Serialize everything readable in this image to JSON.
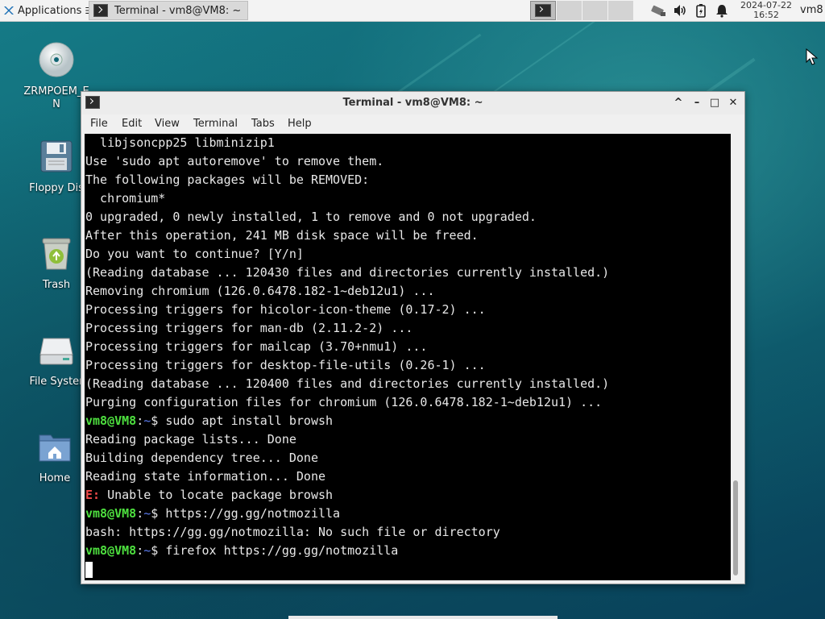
{
  "top_panel": {
    "applications_label": "Applications",
    "applications_suffix": "☰",
    "taskbar_item": "Terminal - vm8@VM8: ~",
    "clock_date": "2024-07-22",
    "clock_time": "16:52",
    "username": "vm8",
    "tray_icons": [
      "network-icon",
      "volume-icon",
      "battery-icon",
      "notification-bell-icon"
    ]
  },
  "desktop": {
    "icons": [
      {
        "label": "ZRMPOEM_E\nN",
        "icon": "cd-disc-icon"
      },
      {
        "label": "Floppy Dis",
        "icon": "floppy-icon"
      },
      {
        "label": "Trash",
        "icon": "trash-icon"
      },
      {
        "label": "File Syster",
        "icon": "drive-icon"
      },
      {
        "label": "Home",
        "icon": "home-folder-icon"
      }
    ]
  },
  "window": {
    "title": "Terminal - vm8@VM8: ~",
    "buttons": {
      "up": "^",
      "minimize": "–",
      "maximize": "□",
      "close": "✕"
    },
    "menu": [
      "File",
      "Edit",
      "View",
      "Terminal",
      "Tabs",
      "Help"
    ]
  },
  "terminal": {
    "lines": [
      {
        "type": "out",
        "text": "  libjsoncpp25 libminizip1"
      },
      {
        "type": "out",
        "text": "Use 'sudo apt autoremove' to remove them."
      },
      {
        "type": "out",
        "text": "The following packages will be REMOVED:"
      },
      {
        "type": "out",
        "text": "  chromium*"
      },
      {
        "type": "out",
        "text": "0 upgraded, 0 newly installed, 1 to remove and 0 not upgraded."
      },
      {
        "type": "out",
        "text": "After this operation, 241 MB disk space will be freed."
      },
      {
        "type": "out",
        "text": "Do you want to continue? [Y/n]"
      },
      {
        "type": "out",
        "text": "(Reading database ... 120430 files and directories currently installed.)"
      },
      {
        "type": "out",
        "text": "Removing chromium (126.0.6478.182-1~deb12u1) ..."
      },
      {
        "type": "out",
        "text": "Processing triggers for hicolor-icon-theme (0.17-2) ..."
      },
      {
        "type": "out",
        "text": "Processing triggers for man-db (2.11.2-2) ..."
      },
      {
        "type": "out",
        "text": "Processing triggers for mailcap (3.70+nmu1) ..."
      },
      {
        "type": "out",
        "text": "Processing triggers for desktop-file-utils (0.26-1) ..."
      },
      {
        "type": "out",
        "text": "(Reading database ... 120400 files and directories currently installed.)"
      },
      {
        "type": "out",
        "text": "Purging configuration files for chromium (126.0.6478.182-1~deb12u1) ..."
      },
      {
        "type": "prompt",
        "user": "vm8@VM8",
        "sep": ":",
        "path": "~",
        "sym": "$ ",
        "cmd": "sudo apt install browsh"
      },
      {
        "type": "out",
        "text": "Reading package lists... Done"
      },
      {
        "type": "out",
        "text": "Building dependency tree... Done"
      },
      {
        "type": "out",
        "text": "Reading state information... Done"
      },
      {
        "type": "err",
        "prefix": "E:",
        "text": " Unable to locate package browsh"
      },
      {
        "type": "prompt",
        "user": "vm8@VM8",
        "sep": ":",
        "path": "~",
        "sym": "$ ",
        "cmd": "https://gg.gg/notmozilla"
      },
      {
        "type": "out",
        "text": "bash: https://gg.gg/notmozilla: No such file or directory"
      },
      {
        "type": "prompt",
        "user": "vm8@VM8",
        "sep": ":",
        "path": "~",
        "sym": "$ ",
        "cmd": "firefox https://gg.gg/notmozilla"
      },
      {
        "type": "cursor"
      }
    ]
  },
  "colors": {
    "prompt_user": "#4ee03f",
    "prompt_path": "#5c7cf0",
    "error": "#ef4a4a",
    "terminal_bg": "#000000",
    "terminal_fg": "#e8e8e8"
  }
}
